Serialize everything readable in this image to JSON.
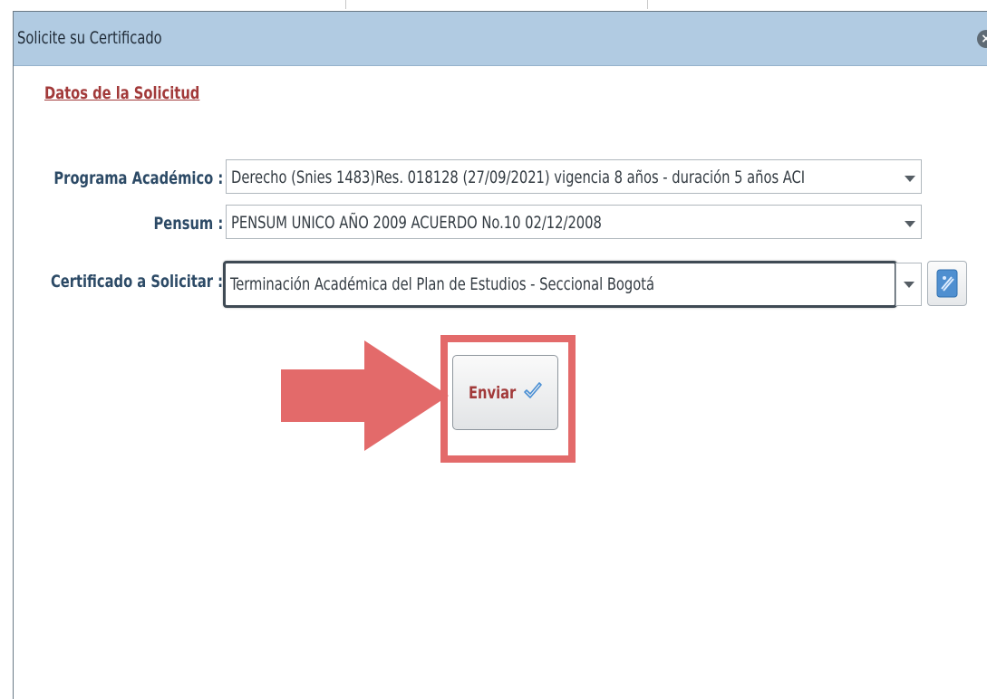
{
  "dialog": {
    "title": "Solicite su Certificado",
    "close_icon": "close-circle-icon"
  },
  "form": {
    "section_heading": "Datos de la Solicitud",
    "programa": {
      "label": "Programa Académico :",
      "value": "Derecho (Snies 1483)Res. 018128 (27/09/2021) vigencia 8 años - duración 5 años ACI"
    },
    "pensum": {
      "label": "Pensum :",
      "value": "PENSUM UNICO AÑO 2009 ACUERDO No.10 02/12/2008"
    },
    "certificado": {
      "label": "Certificado a Solicitar :",
      "value": "Terminación Académica del Plan de Estudios - Seccional Bogotá",
      "help_icon": "help-document-icon"
    },
    "submit": {
      "label": "Enviar",
      "icon": "checkmark-icon"
    }
  },
  "annotation": {
    "arrow_color": "#e36a6a",
    "highlight_color": "#e36a6a"
  }
}
